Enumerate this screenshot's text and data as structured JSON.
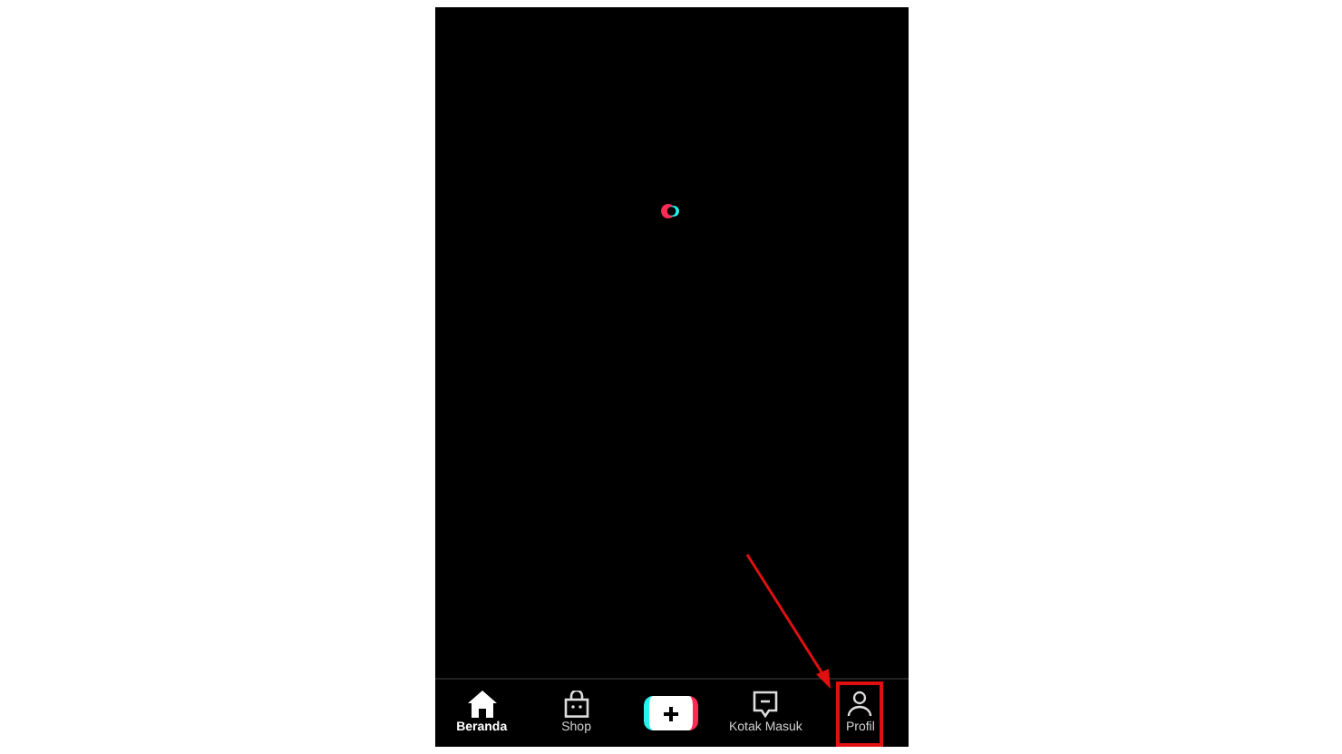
{
  "nav": [
    {
      "kind": "home",
      "label": "Beranda",
      "selected": true,
      "highlighted": false
    },
    {
      "kind": "shop",
      "label": "Shop",
      "selected": false,
      "highlighted": false
    },
    {
      "kind": "create",
      "selected": false,
      "highlighted": false
    },
    {
      "kind": "inbox",
      "label": "Kotak Masuk",
      "selected": false,
      "highlighted": false
    },
    {
      "kind": "profile",
      "label": "Profil",
      "selected": false,
      "highlighted": true
    }
  ]
}
